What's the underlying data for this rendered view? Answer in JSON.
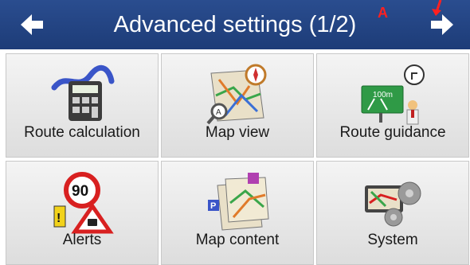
{
  "header": {
    "title": "Advanced settings (1/2)",
    "back_icon": "arrow-left-icon",
    "forward_icon": "arrow-right-icon",
    "annotation_letter": "A",
    "background": "#1d3c78"
  },
  "tiles": [
    {
      "label": "Route calculation",
      "icon": "route-calculator-icon"
    },
    {
      "label": "Map view",
      "icon": "map-compass-icon"
    },
    {
      "label": "Route guidance",
      "icon": "guidance-sign-icon"
    },
    {
      "label": "Alerts",
      "icon": "speed-warning-icon"
    },
    {
      "label": "Map content",
      "icon": "map-layers-icon"
    },
    {
      "label": "System",
      "icon": "gears-device-icon"
    }
  ]
}
